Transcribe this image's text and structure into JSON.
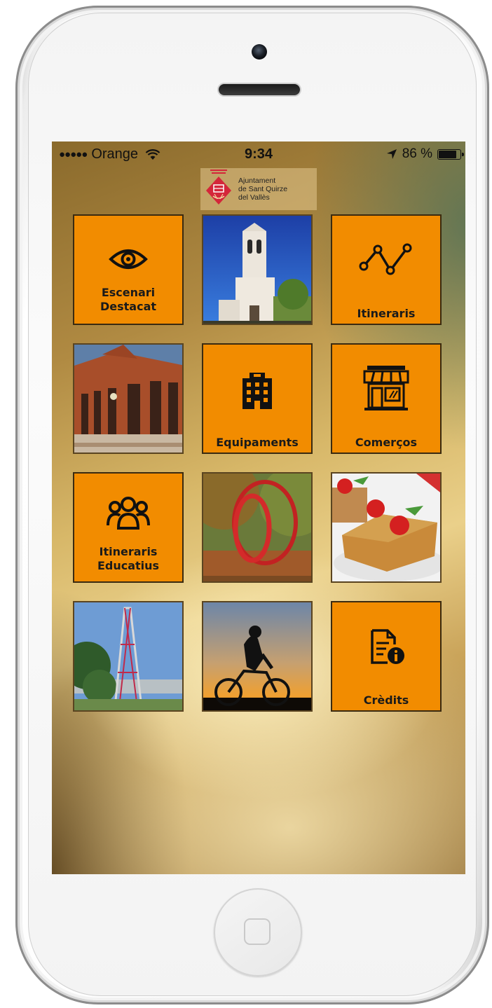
{
  "status_bar": {
    "signal_dots": "●●●●●",
    "carrier": "Orange",
    "time": "9:34",
    "battery_percent": "86 %",
    "battery_level": 0.86
  },
  "logo": {
    "line1": "Ajuntament",
    "line2": "de Sant Quirze",
    "line3": "del Vallès",
    "brand_color": "#d4263a"
  },
  "accent_color": "#f28c00",
  "tiles": [
    {
      "label_lines": [
        "Escenari",
        "Destacat"
      ],
      "icon": "eye-icon"
    },
    {
      "photo": "church-bell-tower-photo"
    },
    {
      "label_lines": [
        "Itineraris"
      ],
      "icon": "route-icon"
    },
    {
      "photo": "brick-building-photo"
    },
    {
      "label_lines": [
        "Equipaments"
      ],
      "icon": "building-icon"
    },
    {
      "label_lines": [
        "Comerços"
      ],
      "icon": "storefront-icon"
    },
    {
      "label_lines": [
        "Itineraris",
        "Educatius"
      ],
      "icon": "group-icon"
    },
    {
      "photo": "red-sculpture-photo"
    },
    {
      "photo": "cherry-cake-photo"
    },
    {
      "photo": "lattice-tower-photo"
    },
    {
      "photo": "cyclist-sunset-photo"
    },
    {
      "label_lines": [
        "Crèdits"
      ],
      "icon": "document-info-icon"
    }
  ]
}
